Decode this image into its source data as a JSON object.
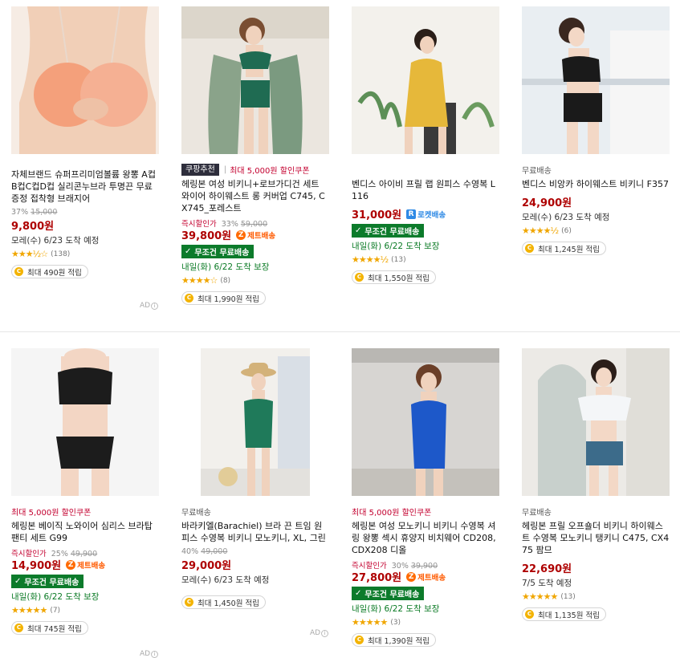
{
  "products": [
    {
      "id": 0,
      "title": "자체브랜드 슈퍼프리미엄볼륨 왕뽕 A컵B컵C컵D컵 실리콘누브라 투명끈 무료증정 접착형 브래지어",
      "discount_pct": "37%",
      "original_price": "15,000",
      "price": "9,800원",
      "arrival": "모레(수) 6/23 도착 예정",
      "stars": "★★★½☆",
      "reviews": "(138)",
      "reward": "최대 490원 적립",
      "ad": "AD"
    },
    {
      "id": 1,
      "pick_label": "쿠팡추천",
      "coupon": "최대 5,000원 할인쿠폰",
      "title": "헤링본 여성 비키니+로브가디건 세트 와이어 하이웨스트 롱 커버업 C745, CX745_포레스트",
      "instant_label": "즉시할인가",
      "discount_pct": "33%",
      "original_price": "59,000",
      "price": "39,800원",
      "badge": "제트배송",
      "free_shipping": "무조건 무료배송",
      "arrival": "내일(화) 6/22 도착 보장",
      "stars": "★★★★☆",
      "reviews": "(8)",
      "reward": "최대 1,990원 적립"
    },
    {
      "id": 2,
      "title": "벤디스 아이비 프릴 랩 원피스 수영복 L116",
      "price": "31,000원",
      "badge": "로켓배송",
      "free_shipping": "무조건 무료배송",
      "arrival": "내일(화) 6/22 도착 보장",
      "stars": "★★★★½",
      "reviews": "(13)",
      "reward": "최대 1,550원 적립"
    },
    {
      "id": 3,
      "shipping_label": "무료배송",
      "title": "벤디스 비앙카 하이웨스트 비키니 F357",
      "price": "24,900원",
      "arrival": "모레(수) 6/23 도착 예정",
      "stars": "★★★★½",
      "reviews": "(6)",
      "reward": "최대 1,245원 적립"
    },
    {
      "id": 4,
      "coupon": "최대 5,000원 할인쿠폰",
      "title": "헤링본 베이직 노와이어 심리스 브라탑 팬티 세트 G99",
      "instant_label": "즉시할인가",
      "discount_pct": "25%",
      "original_price": "49,900",
      "price": "14,900원",
      "badge": "제트배송",
      "free_shipping": "무조건 무료배송",
      "arrival": "내일(화) 6/22 도착 보장",
      "stars": "★★★★★",
      "reviews": "(7)",
      "reward": "최대 745원 적립",
      "ad": "AD"
    },
    {
      "id": 5,
      "shipping_label": "무료배송",
      "title": "바라키엘(Barachiel) 브라 끈 트임 원피스 수영복 비키니 모노키니, XL, 그린",
      "discount_pct": "40%",
      "original_price": "49,000",
      "price": "29,000원",
      "arrival": "모레(수) 6/23 도착 예정",
      "reward": "최대 1,450원 적립",
      "ad": "AD"
    },
    {
      "id": 6,
      "coupon": "최대 5,000원 할인쿠폰",
      "title": "헤링본 여성 모노키니 비키니 수영복 셔링 왕뽕 섹시 휴양지 비치웨어 CD208, CDX208 디올",
      "instant_label": "즉시할인가",
      "discount_pct": "30%",
      "original_price": "39,900",
      "price": "27,800원",
      "badge": "제트배송",
      "free_shipping": "무조건 무료배송",
      "arrival": "내일(화) 6/22 도착 보장",
      "stars": "★★★★★",
      "reviews": "(3)",
      "reward": "최대 1,390원 적립"
    },
    {
      "id": 7,
      "shipping_label": "무료배송",
      "title": "헤링본 프릴 오프숄더 비키니 하이웨스트 수영복 모노키니 탱키니 C475, CX475 팜므",
      "price": "22,690원",
      "arrival": "7/5 도착 예정",
      "stars": "★★★★★",
      "reviews": "(13)",
      "reward": "최대 1,135원 적립"
    }
  ],
  "icons": {
    "coin": "C",
    "check": "✓",
    "jet": "Z",
    "rocket": "R",
    "info": "i"
  },
  "colors": {
    "price": "#ae0000",
    "free_shipping_bg": "#0c7b2b",
    "jet": "#ff5a00",
    "rocket": "#2f8ae5",
    "star": "#f0a600"
  }
}
